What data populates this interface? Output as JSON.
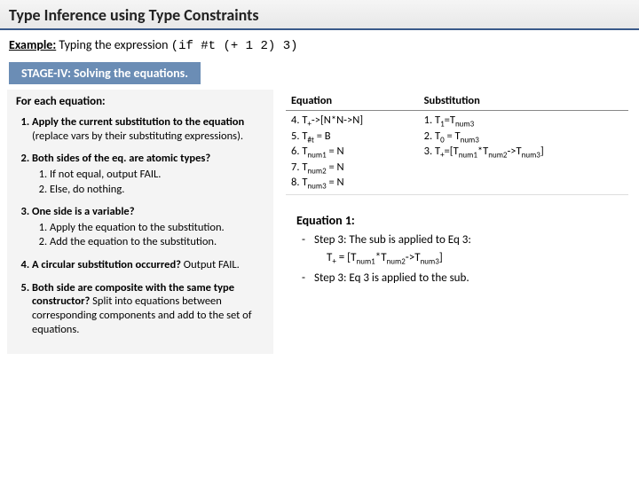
{
  "title": "Type Inference using Type Constraints",
  "example_label": "Example:",
  "example_text1": "Typing the expression ",
  "example_code": "(if #t  (+ 1 2)  3)",
  "stage": "STAGE-IV: Solving the equations.",
  "left": {
    "heading": "For each equation:",
    "step1_bold": "Apply the current substitution to the equation ",
    "step1_rest": "(replace vars by their substituting expressions).",
    "step2_bold": "Both sides of the eq. are atomic types?",
    "step2_a": "If not equal, output FAIL.",
    "step2_b": "Else, do nothing.",
    "step3_bold": "One side is a variable?",
    "step3_a": "Apply the equation to the substitution.",
    "step3_b": "Add the equation to the substitution.",
    "step4_bold": "A circular substitution occurred? ",
    "step4_rest": "Output FAIL.",
    "step5_bold": "Both side are composite with the same type constructor? ",
    "step5_rest": "Split into equations between corresponding components and add to the set of equations."
  },
  "table": {
    "hdr_eq": "Equation",
    "hdr_sub": "Substitution",
    "eq4": "4. T+->[N*N->N]",
    "eq5": "5. T#t = B",
    "eq6": "6. Tnum1 = N",
    "eq7": "7. Tnum2 = N",
    "eq8": "8. Tnum3 = N",
    "sub1": "1. T1=Tnum3",
    "sub2": "2. T0 = Tnum3",
    "sub3": "3. T+=[Tnum1*Tnum2->Tnum3]"
  },
  "eq_block": {
    "title": "Equation 1:",
    "line1": "Step 3: The sub is applied to Eq 3:",
    "expr": "T+ = [Tnum1*Tnum2->Tnum3]",
    "line2": "Step 3: Eq 3 is applied to the sub."
  }
}
